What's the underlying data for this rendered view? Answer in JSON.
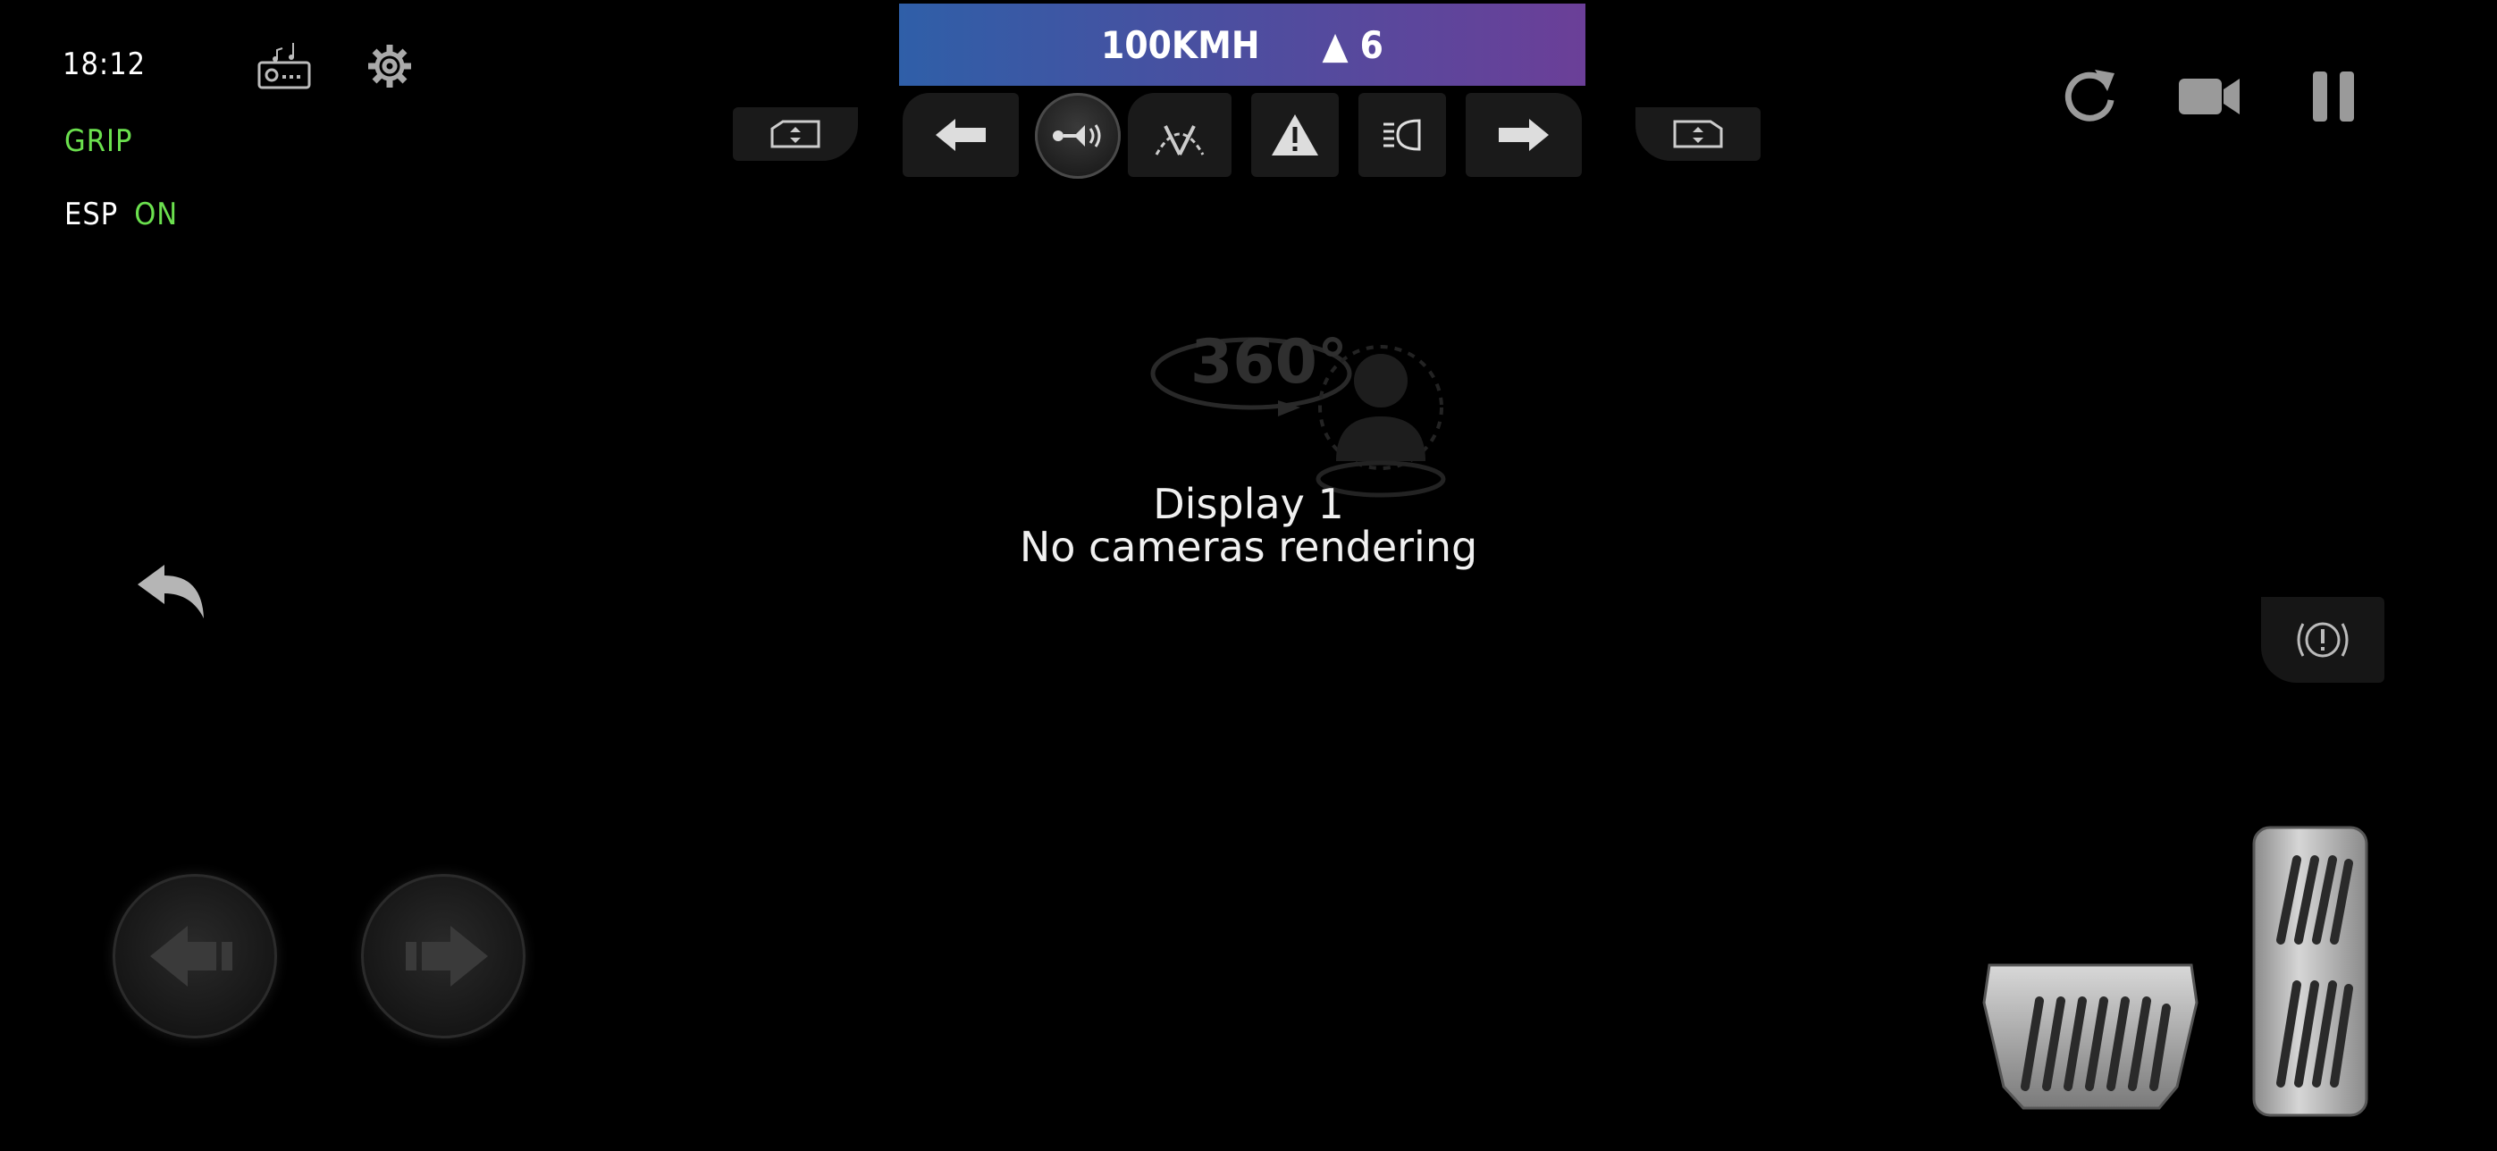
{
  "hud": {
    "clock": "18:12",
    "grip": "GRIP",
    "esp_label": "ESP",
    "esp_state": "ON"
  },
  "speedbar": {
    "speed": "100KMH",
    "gear": "▲ 6"
  },
  "display": {
    "line1": "Display 1",
    "line2": "No cameras rendering"
  },
  "icons": {
    "radio": "radio-icon",
    "settings": "gear-icon",
    "reset": "reset-icon",
    "camera": "camera-icon",
    "pause": "pause-icon"
  },
  "colors": {
    "green": "#6be04e",
    "speed_from": "#2f5fa8",
    "speed_to": "#6b3f98"
  }
}
